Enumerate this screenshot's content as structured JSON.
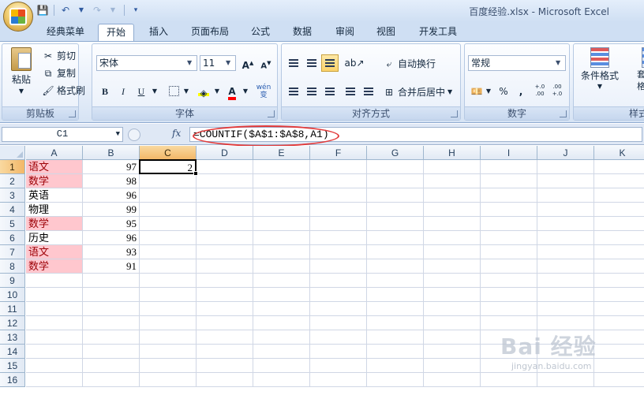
{
  "window": {
    "title": "百度经验.xlsx - Microsoft Excel"
  },
  "colors": {
    "accent": "#2f5aa0",
    "highlight_ellipse": "#e23a3a",
    "pink_fill": "#ffc7ce",
    "pink_text": "#9c0006",
    "selected_header": "#f2b768"
  },
  "quick_access": [
    {
      "icon": "save-icon",
      "glyph": "💾"
    },
    {
      "icon": "undo-icon",
      "glyph": "↶"
    },
    {
      "icon": "redo-icon",
      "glyph": "↷"
    }
  ],
  "tabs": [
    "经典菜单",
    "开始",
    "插入",
    "页面布局",
    "公式",
    "数据",
    "审阅",
    "视图",
    "开发工具"
  ],
  "active_tab": "开始",
  "ribbon": {
    "clipboard": {
      "label": "剪贴板",
      "paste": "粘贴",
      "cut": "剪切",
      "copy": "复制",
      "format_painter": "格式刷"
    },
    "font": {
      "label": "字体",
      "font_name": "宋体",
      "font_size": "11",
      "bold": "B",
      "italic": "I",
      "underline": "U",
      "grow": "A",
      "shrink": "A",
      "font_color_letter": "A",
      "phonetic": "wén 变"
    },
    "alignment": {
      "label": "对齐方式",
      "wrap_text": "自动换行",
      "merge_center": "合并后居中"
    },
    "number": {
      "label": "数字",
      "format": "常规",
      "percent": "%",
      "comma": ",",
      "inc_decimal": "+.0 .00",
      "dec_decimal": ".00 +.0"
    },
    "styles": {
      "label": "样式",
      "conditional": "条件格式",
      "table": "套用表格格式"
    }
  },
  "formula_bar": {
    "name_box": "C1",
    "fx": "fx",
    "formula": "=COUNTIF($A$1:$A$8,A1)"
  },
  "columns": [
    "A",
    "B",
    "C",
    "D",
    "E",
    "F",
    "G",
    "H",
    "I",
    "J",
    "K"
  ],
  "selected_column": "C",
  "selected_row": 1,
  "row_count": 16,
  "rows": [
    {
      "a": "语文",
      "b": "97",
      "c": "2",
      "pink": true
    },
    {
      "a": "数学",
      "b": "98",
      "c": "",
      "pink": true
    },
    {
      "a": "英语",
      "b": "96",
      "c": "",
      "pink": false
    },
    {
      "a": "物理",
      "b": "99",
      "c": "",
      "pink": false
    },
    {
      "a": "数学",
      "b": "95",
      "c": "",
      "pink": true
    },
    {
      "a": "历史",
      "b": "96",
      "c": "",
      "pink": false
    },
    {
      "a": "语文",
      "b": "93",
      "c": "",
      "pink": true
    },
    {
      "a": "数学",
      "b": "91",
      "c": "",
      "pink": true
    }
  ],
  "watermark": {
    "logo": "Bai 经验",
    "sub": "jingyan.baidu.com"
  }
}
